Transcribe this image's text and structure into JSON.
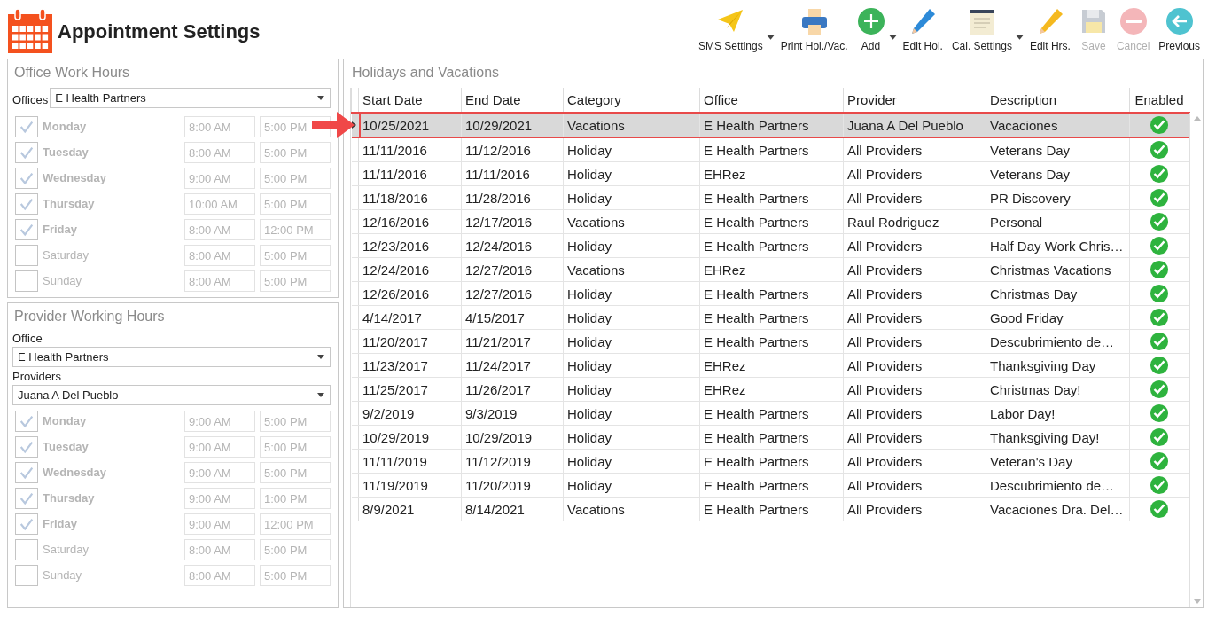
{
  "window": {
    "title": "Appointment Settings"
  },
  "toolbar": [
    {
      "kind": "plane",
      "label": "SMS Settings",
      "dropdown": true,
      "disabled": false
    },
    {
      "kind": "printer",
      "label": "Print Hol./Vac.",
      "dropdown": false,
      "disabled": false
    },
    {
      "kind": "add",
      "label": "Add",
      "dropdown": true,
      "disabled": false
    },
    {
      "kind": "bluepencil",
      "label": "Edit Hol.",
      "dropdown": false,
      "disabled": false
    },
    {
      "kind": "notepad",
      "label": "Cal. Settings",
      "dropdown": true,
      "disabled": false
    },
    {
      "kind": "pencil",
      "label": "Edit Hrs.",
      "dropdown": false,
      "disabled": false
    },
    {
      "kind": "save",
      "label": "Save",
      "dropdown": false,
      "disabled": true
    },
    {
      "kind": "cancel",
      "label": "Cancel",
      "dropdown": false,
      "disabled": true
    },
    {
      "kind": "back",
      "label": "Previous",
      "dropdown": false,
      "disabled": false
    }
  ],
  "office_hours": {
    "title": "Office Work Hours",
    "office_label": "Offices",
    "office": "E Health Partners",
    "days": [
      {
        "day": "Monday",
        "checked": true,
        "start": "8:00 AM",
        "end": "5:00 PM"
      },
      {
        "day": "Tuesday",
        "checked": true,
        "start": "8:00 AM",
        "end": "5:00 PM"
      },
      {
        "day": "Wednesday",
        "checked": true,
        "start": "9:00 AM",
        "end": "5:00 PM"
      },
      {
        "day": "Thursday",
        "checked": true,
        "start": "10:00 AM",
        "end": "5:00 PM"
      },
      {
        "day": "Friday",
        "checked": true,
        "start": "8:00 AM",
        "end": "12:00 PM"
      },
      {
        "day": "Saturday",
        "checked": false,
        "start": "8:00 AM",
        "end": "5:00 PM"
      },
      {
        "day": "Sunday",
        "checked": false,
        "start": "8:00 AM",
        "end": "5:00 PM"
      }
    ]
  },
  "provider_hours": {
    "title": "Provider Working Hours",
    "office_label": "Office",
    "office": "E Health Partners",
    "providers_label": "Providers",
    "provider": "Juana A Del Pueblo",
    "days": [
      {
        "day": "Monday",
        "checked": true,
        "start": "9:00 AM",
        "end": "5:00 PM"
      },
      {
        "day": "Tuesday",
        "checked": true,
        "start": "9:00 AM",
        "end": "5:00 PM"
      },
      {
        "day": "Wednesday",
        "checked": true,
        "start": "9:00 AM",
        "end": "5:00 PM"
      },
      {
        "day": "Thursday",
        "checked": true,
        "start": "9:00 AM",
        "end": "1:00 PM"
      },
      {
        "day": "Friday",
        "checked": true,
        "start": "9:00 AM",
        "end": "12:00 PM"
      },
      {
        "day": "Saturday",
        "checked": false,
        "start": "8:00 AM",
        "end": "5:00 PM"
      },
      {
        "day": "Sunday",
        "checked": false,
        "start": "8:00 AM",
        "end": "5:00 PM"
      }
    ]
  },
  "holidays": {
    "title": "Holidays and Vacations",
    "columns": [
      "Start Date",
      "End Date",
      "Category",
      "Office",
      "Provider",
      "Description",
      "Enabled"
    ],
    "rows": [
      {
        "cells": [
          "10/25/2021",
          "10/29/2021",
          "Vacations",
          "E Health Partners",
          "Juana A Del Pueblo",
          "Vacaciones"
        ],
        "enabled": true,
        "selected": true
      },
      {
        "cells": [
          "11/11/2016",
          "11/12/2016",
          "Holiday",
          "E Health Partners",
          "All Providers",
          "Veterans Day"
        ],
        "enabled": true,
        "selected": false
      },
      {
        "cells": [
          "11/11/2016",
          "11/11/2016",
          "Holiday",
          "EHRez",
          "All Providers",
          "Veterans Day"
        ],
        "enabled": true,
        "selected": false
      },
      {
        "cells": [
          "11/18/2016",
          "11/28/2016",
          "Holiday",
          "E Health Partners",
          "All Providers",
          "PR Discovery"
        ],
        "enabled": true,
        "selected": false
      },
      {
        "cells": [
          "12/16/2016",
          "12/17/2016",
          "Vacations",
          "E Health Partners",
          "Raul Rodriguez",
          "Personal"
        ],
        "enabled": true,
        "selected": false
      },
      {
        "cells": [
          "12/23/2016",
          "12/24/2016",
          "Holiday",
          "E Health Partners",
          "All Providers",
          "Half Day Work Chris…"
        ],
        "enabled": true,
        "selected": false
      },
      {
        "cells": [
          "12/24/2016",
          "12/27/2016",
          "Vacations",
          "EHRez",
          "All Providers",
          "Christmas Vacations"
        ],
        "enabled": true,
        "selected": false
      },
      {
        "cells": [
          "12/26/2016",
          "12/27/2016",
          "Holiday",
          "E Health Partners",
          "All Providers",
          "Christmas Day"
        ],
        "enabled": true,
        "selected": false
      },
      {
        "cells": [
          "4/14/2017",
          "4/15/2017",
          "Holiday",
          "E Health Partners",
          "All Providers",
          "Good Friday"
        ],
        "enabled": true,
        "selected": false
      },
      {
        "cells": [
          "11/20/2017",
          "11/21/2017",
          "Holiday",
          "E Health Partners",
          "All Providers",
          "Descubrimiento de…"
        ],
        "enabled": true,
        "selected": false
      },
      {
        "cells": [
          "11/23/2017",
          "11/24/2017",
          "Holiday",
          "EHRez",
          "All Providers",
          "Thanksgiving Day"
        ],
        "enabled": true,
        "selected": false
      },
      {
        "cells": [
          "11/25/2017",
          "11/26/2017",
          "Holiday",
          "EHRez",
          "All Providers",
          "Christmas Day!"
        ],
        "enabled": true,
        "selected": false
      },
      {
        "cells": [
          "9/2/2019",
          "9/3/2019",
          "Holiday",
          "E Health Partners",
          "All Providers",
          "Labor Day!"
        ],
        "enabled": true,
        "selected": false
      },
      {
        "cells": [
          "10/29/2019",
          "10/29/2019",
          "Holiday",
          "E Health Partners",
          "All Providers",
          "Thanksgiving Day!"
        ],
        "enabled": true,
        "selected": false
      },
      {
        "cells": [
          "11/11/2019",
          "11/12/2019",
          "Holiday",
          "E Health Partners",
          "All Providers",
          "Veteran's Day"
        ],
        "enabled": true,
        "selected": false
      },
      {
        "cells": [
          "11/19/2019",
          "11/20/2019",
          "Holiday",
          "E Health Partners",
          "All Providers",
          "Descubrimiento de…"
        ],
        "enabled": true,
        "selected": false
      },
      {
        "cells": [
          "8/9/2021",
          "8/14/2021",
          "Vacations",
          "E Health Partners",
          "All Providers",
          "Vacaciones Dra. Del…"
        ],
        "enabled": true,
        "selected": false
      }
    ]
  }
}
